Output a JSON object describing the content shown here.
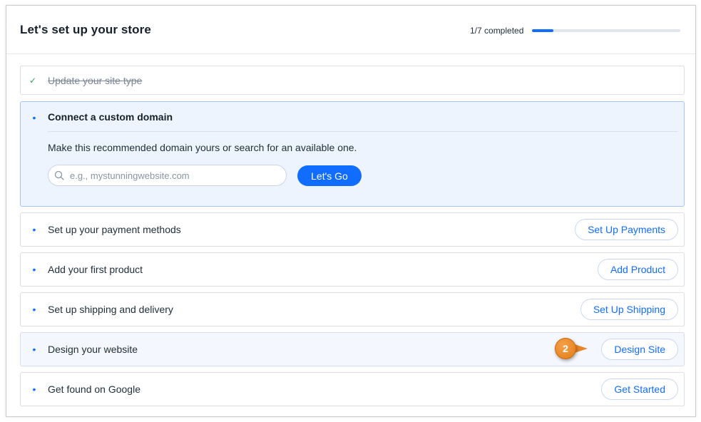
{
  "header": {
    "title": "Let's set up your store",
    "progress_text": "1/7 completed",
    "progress_fraction": 0.143
  },
  "completed_step": {
    "label": "Update your site type"
  },
  "expanded_step": {
    "title": "Connect a custom domain",
    "description": "Make this recommended domain yours or search for an available one.",
    "search_placeholder": "e.g., mystunningwebsite.com",
    "search_value": "",
    "button_label": "Let's Go"
  },
  "steps": [
    {
      "label": "Set up your payment methods",
      "action": "Set Up Payments"
    },
    {
      "label": "Add your first product",
      "action": "Add Product"
    },
    {
      "label": "Set up shipping and delivery",
      "action": "Set Up Shipping"
    },
    {
      "label": "Design your website",
      "action": "Design Site"
    },
    {
      "label": "Get found on Google",
      "action": "Get Started"
    }
  ],
  "callout": {
    "number": "2"
  },
  "colors": {
    "accent": "#116dff",
    "callout": "#e8852a",
    "check": "#25a55f"
  }
}
